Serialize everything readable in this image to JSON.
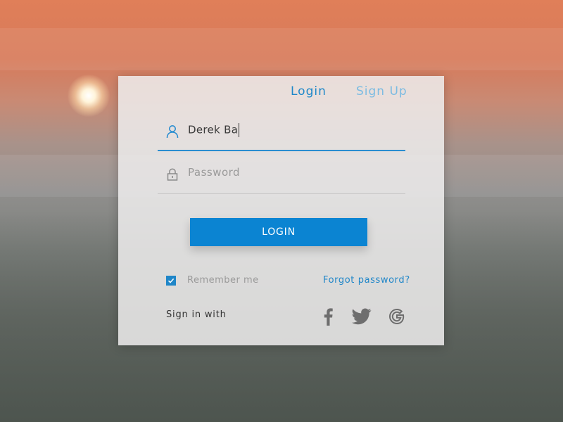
{
  "tabs": {
    "login": "Login",
    "signup": "Sign Up"
  },
  "username": {
    "value": "Derek Ba",
    "icon": "user-icon"
  },
  "password": {
    "placeholder": "Password",
    "icon": "lock-icon"
  },
  "login_button": "LOGIN",
  "remember": {
    "label": "Remember me",
    "checked": true
  },
  "forgot_label": "Forgot password?",
  "social": {
    "label": "Sign in with",
    "icons": [
      "facebook-icon",
      "twitter-icon",
      "google-icon"
    ]
  },
  "colors": {
    "accent": "#0b84d2",
    "tab_active": "#1d87c9",
    "tab_inactive": "#7bbbe2"
  }
}
